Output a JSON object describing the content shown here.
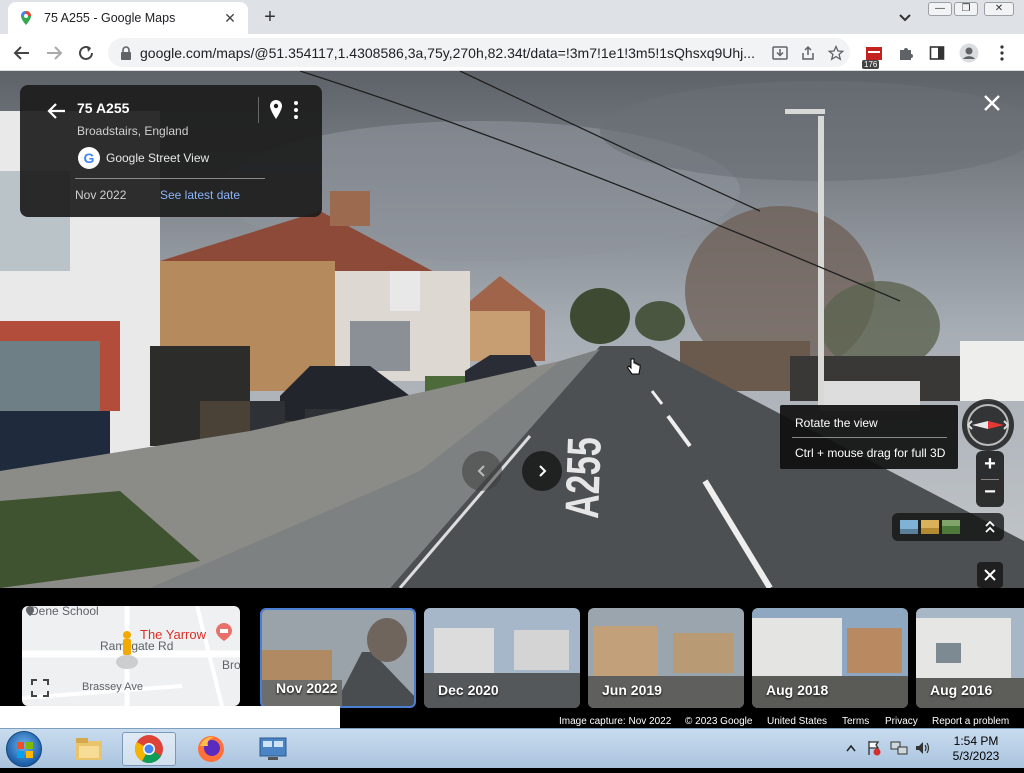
{
  "browser": {
    "tab_title": "75 A255 - Google Maps",
    "url": "google.com/maps/@51.354117,1.4308586,3a,75y,270h,82.34t/data=!3m7!1e1!3m5!1sQhsxq9Uhj...",
    "extension_badge": "176"
  },
  "place": {
    "title": "75 A255",
    "subtitle": "Broadstairs, England",
    "source": "Google Street View",
    "capture_date": "Nov 2022",
    "latest_link": "See latest date"
  },
  "tooltip": {
    "line1": "Rotate the view",
    "line2": "Ctrl + mouse drag for full 3D"
  },
  "road_marking": "A255",
  "minimap": {
    "school": "Dene School",
    "poi": "The Yarrow",
    "road1": "Ramsgate Rd",
    "road2": "Brassey Ave",
    "partial": "Bro"
  },
  "timeline": [
    {
      "label": "Nov 2022",
      "selected": true
    },
    {
      "label": "Dec 2020",
      "selected": false
    },
    {
      "label": "Jun 2019",
      "selected": false
    },
    {
      "label": "Aug 2018",
      "selected": false
    },
    {
      "label": "Aug 2016",
      "selected": false
    }
  ],
  "footer": {
    "capture": "Image capture: Nov 2022",
    "copyright": "© 2023 Google",
    "region": "United States",
    "terms": "Terms",
    "privacy": "Privacy",
    "report": "Report a problem"
  },
  "taskbar": {
    "time": "1:54 PM",
    "date": "5/3/2023"
  }
}
